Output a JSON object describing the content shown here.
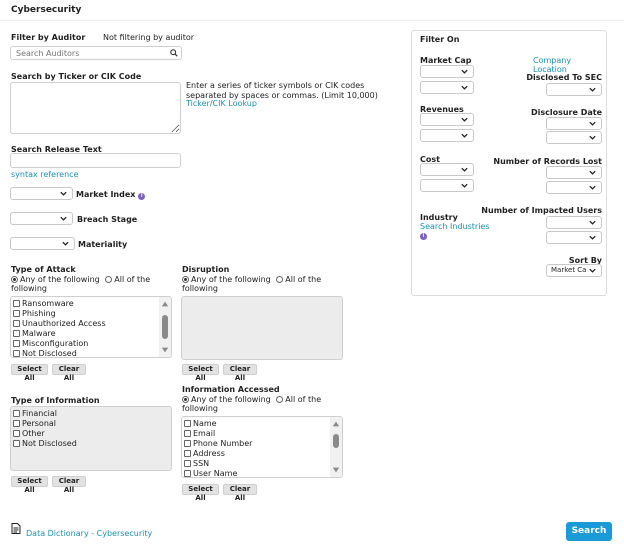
{
  "page": {
    "title": "Cybersecurity"
  },
  "auditor": {
    "label": "Filter by Auditor",
    "status": "Not filtering by auditor",
    "placeholder": "Search Auditors"
  },
  "ticker": {
    "label": "Search by Ticker or CIK Code",
    "help": "Enter a series of ticker symbols or CIK codes separated by spaces or commas. (Limit 10,000)",
    "lookup_link": "Ticker/CIK Lookup"
  },
  "release_text": {
    "label": "Search Release Text",
    "syntax_link": "syntax reference"
  },
  "dropdowns": {
    "market_index": "Market Index",
    "breach_stage": "Breach Stage",
    "materiality": "Materiality"
  },
  "type_of_attack": {
    "label": "Type of Attack",
    "radio_any": "Any of the following",
    "radio_all": "All of the following",
    "items": [
      "Ransomware",
      "Phishing",
      "Unauthorized Access",
      "Malware",
      "Misconfiguration",
      "Not Disclosed"
    ],
    "select_all": "Select All",
    "clear_all": "Clear All"
  },
  "disruption": {
    "label": "Disruption",
    "radio_any": "Any of the following",
    "radio_all": "All of the following",
    "select_all": "Select All",
    "clear_all": "Clear All"
  },
  "type_of_information": {
    "label": "Type of Information",
    "items": [
      "Financial",
      "Personal",
      "Other",
      "Not Disclosed"
    ],
    "select_all": "Select All",
    "clear_all": "Clear All"
  },
  "information_accessed": {
    "label": "Information Accessed",
    "radio_any": "Any of the following",
    "radio_all": "All of the following",
    "items": [
      "Name",
      "Email",
      "Phone Number",
      "Address",
      "SSN",
      "User Name"
    ],
    "select_all": "Select All",
    "clear_all": "Clear All"
  },
  "filter_on": {
    "label": "Filter On",
    "market_cap": "Market Cap",
    "company_location": "Company Location",
    "disclosed_to_sec": "Disclosed To SEC",
    "revenues": "Revenues",
    "disclosure_date": "Disclosure Date",
    "cost": "Cost",
    "records_lost": "Number of Records Lost",
    "industry": "Industry",
    "search_industries": "Search Industries",
    "impacted_users": "Number of Impacted Users",
    "sort_by": "Sort By",
    "sort_value": "Market Ca"
  },
  "footer": {
    "dictionary_link": "Data Dictionary - Cybersecurity",
    "search_button": "Search"
  },
  "colors": {
    "accent": "#1a9ad6",
    "link": "#1a8fb7"
  }
}
